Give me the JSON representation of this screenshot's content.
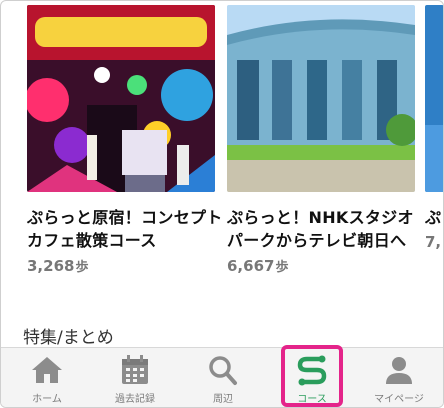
{
  "cards": [
    {
      "title_line1": "ぷらっと原宿！コンセプト",
      "title_line2": "カフェ散策コース",
      "steps": "3,268",
      "unit": "歩"
    },
    {
      "title_line1": "ぷらっと！NHKスタジオ",
      "title_line2": "パークからテレビ朝日へ",
      "steps": "6,667",
      "unit": "歩"
    },
    {
      "title_line1": "ぷ",
      "title_line2": "7,",
      "steps": "",
      "unit": ""
    }
  ],
  "section": {
    "title": "特集/まとめ"
  },
  "tabs": {
    "home": "ホーム",
    "history": "過去記録",
    "nearby": "周辺",
    "course": "コース",
    "mypage": "マイページ"
  },
  "colors": {
    "accent": "#2a9d5c",
    "highlight": "#e4248a",
    "tab_icon": "#8c8c8c"
  }
}
